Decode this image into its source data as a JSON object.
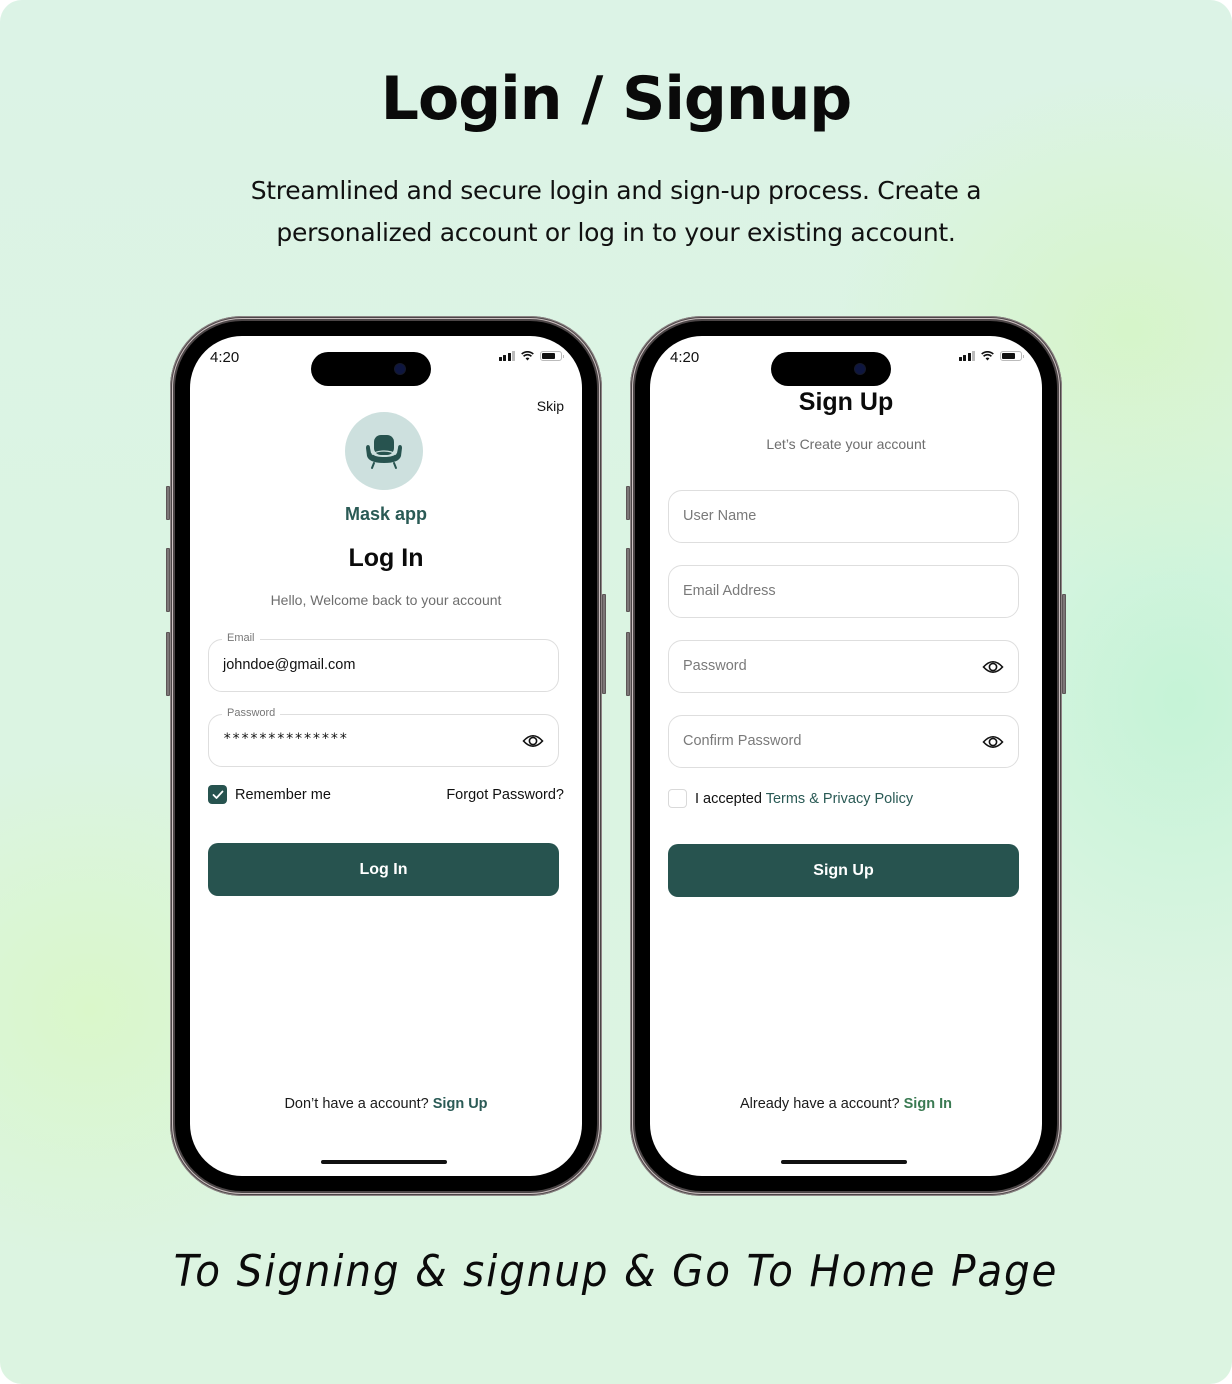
{
  "header": {
    "title": "Login / Signup",
    "subtitle_line1": "Streamlined and secure login and sign-up process. Create a",
    "subtitle_line2": "personalized account or log in to your existing account."
  },
  "caption": "To Signing & signup & Go To Home Page",
  "colors": {
    "brand": "#27534f",
    "brand_light": "#cde0de",
    "link_alt": "#3a7a52",
    "background": "#dbf4e2"
  },
  "status_bar": {
    "time": "4:20",
    "icons": [
      "signal-icon",
      "wifi-icon",
      "battery-icon"
    ]
  },
  "login": {
    "skip_label": "Skip",
    "logo_icon": "armchair-icon",
    "app_name": "Mask app",
    "title": "Log In",
    "subtitle": "Hello, Welcome back to your account",
    "email": {
      "label": "Email",
      "value": "johndoe@gmail.com"
    },
    "password": {
      "label": "Password",
      "value": "**************",
      "toggle_icon": "eye-icon"
    },
    "remember_me": {
      "label": "Remember me",
      "checked": true
    },
    "forgot_password": "Forgot Password?",
    "submit_label": "Log In",
    "footer_text": "Don’t have a account?",
    "footer_link": "Sign Up"
  },
  "signup": {
    "title": "Sign Up",
    "subtitle": "Let’s Create your account",
    "fields": [
      {
        "placeholder": "User Name"
      },
      {
        "placeholder": "Email Address"
      },
      {
        "placeholder": "Password",
        "toggle_icon": "eye-icon"
      },
      {
        "placeholder": "Confirm Password",
        "toggle_icon": "eye-icon"
      }
    ],
    "terms": {
      "prefix": "I accepted",
      "link": "Terms & Privacy Policy",
      "checked": false
    },
    "submit_label": "Sign Up",
    "footer_text": "Already have a account?",
    "footer_link": "Sign In"
  }
}
